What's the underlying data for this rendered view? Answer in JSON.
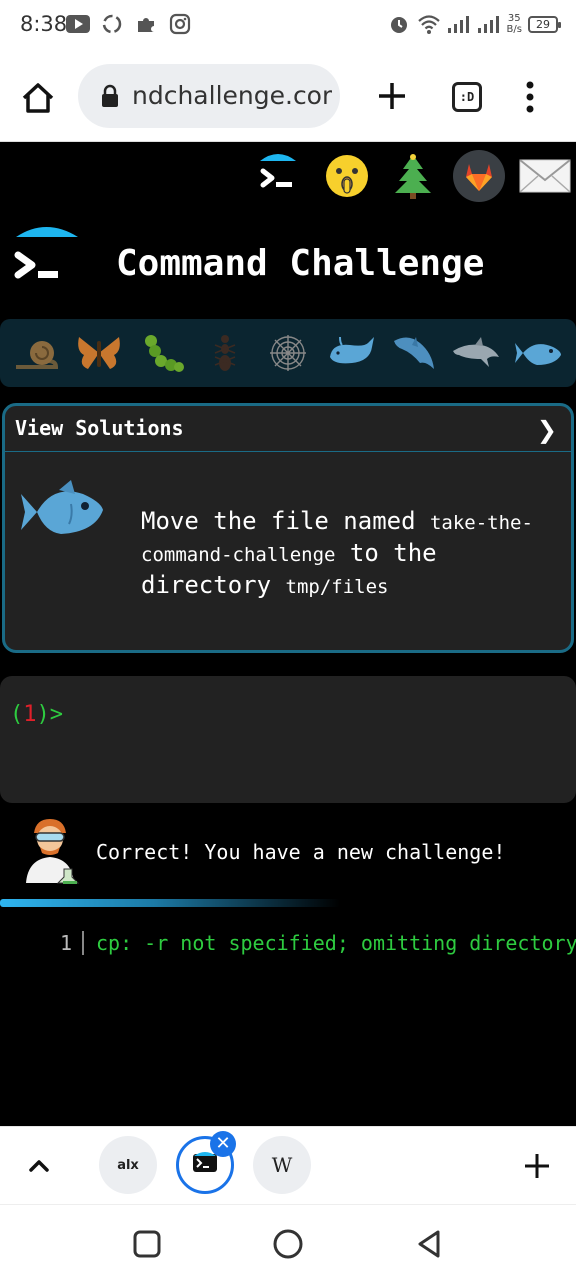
{
  "status_bar": {
    "time": "8:38",
    "net_speed_value": "35",
    "net_speed_unit": "B/s",
    "battery": "29"
  },
  "browser": {
    "url": "ndchallenge.com",
    "tabs_label": ":D"
  },
  "page": {
    "title": "Command Challenge",
    "top_icons": [
      "terminal-icon",
      "shushing-face-icon",
      "pine-tree-icon",
      "gitlab-icon",
      "mail-icon"
    ],
    "levels": [
      "snail-icon",
      "butterfly-icon",
      "caterpillar-icon",
      "ant-icon",
      "spider-web-icon",
      "whale-icon",
      "dolphin-icon",
      "dolphin-icon",
      "fish-icon"
    ],
    "challenge": {
      "header": "View Solutions",
      "text_before": "Move the file named ",
      "file": "take-the-command-challenge",
      "text_middle": " to the directory ",
      "dir": "tmp/files"
    },
    "terminal": {
      "prompt_open": "(",
      "prompt_num": "1",
      "prompt_close": ")>"
    },
    "feedback": "Correct! You have a new challenge!",
    "output": {
      "line_number": "1",
      "message": "cp: -r not specified; omitting directory"
    }
  },
  "tab_strip": {
    "tabs": [
      "alx",
      "terminal",
      "W"
    ]
  },
  "colors": {
    "accent": "#1a6b86",
    "prompt_green": "#2ecc40",
    "prompt_red": "#e0202a",
    "fish_blue": "#5aa6d6"
  }
}
